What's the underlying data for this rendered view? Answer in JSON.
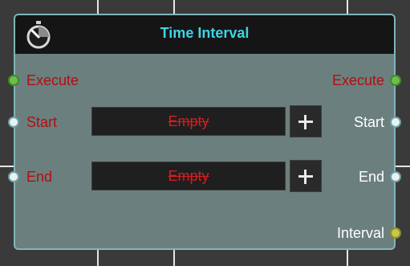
{
  "node": {
    "title": "Time Interval",
    "icon": "stopwatch-icon",
    "inputs": {
      "execute": "Execute",
      "start": "Start",
      "end": "End"
    },
    "outputs": {
      "execute": "Execute",
      "start": "Start",
      "end": "End",
      "interval": "Interval"
    },
    "fields": {
      "start_value": "Empty",
      "end_value": "Empty"
    },
    "colors": {
      "title": "#3fd4e6",
      "input_label": "#b10f0f",
      "output_label": "#ffffff",
      "exec_pin": "#6cc04a",
      "data_pin": "#e8f2f3",
      "interval_pin": "#c9c64a"
    }
  }
}
